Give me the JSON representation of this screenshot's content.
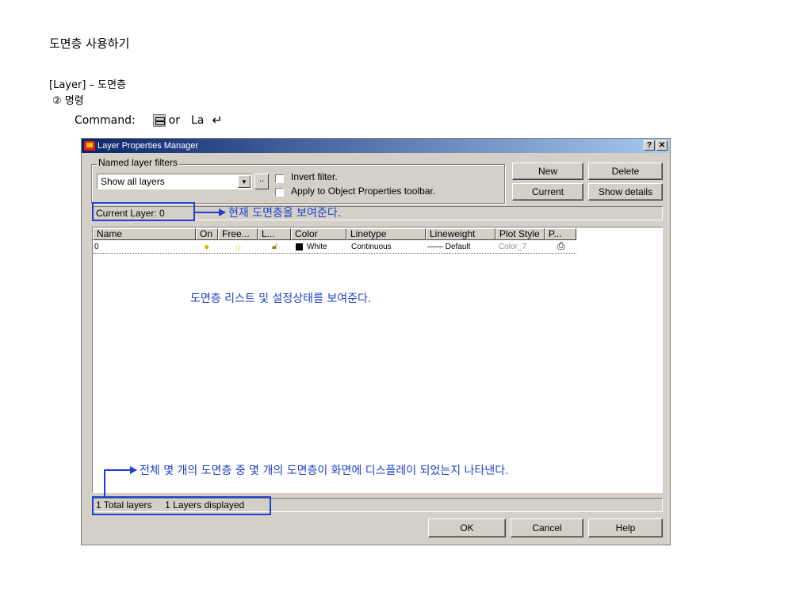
{
  "document": {
    "title": "도면층 사용하기",
    "subtitle": "[Layer] – 도면층",
    "section": "② 명령",
    "command_label": "Command:",
    "command_or": "or",
    "command_alias": "La",
    "enter_glyph": "↵"
  },
  "dialog": {
    "title": "Layer Properties Manager",
    "help_btn": "?",
    "close_btn": "✕",
    "filters": {
      "group_label": "Named layer filters",
      "selected": "Show all layers",
      "more_btn": "··",
      "invert_label": "Invert filter.",
      "apply_label": "Apply to Object Properties toolbar."
    },
    "buttons": {
      "new": "New",
      "delete": "Delete",
      "current": "Current",
      "show_details": "Show details"
    },
    "current_layer": "Current Layer:  0",
    "columns": [
      "Name",
      "On",
      "Free...",
      "L...",
      "Color",
      "Linetype",
      "Lineweight",
      "Plot Style",
      "P..."
    ],
    "rows": [
      {
        "name": "0",
        "color": "White",
        "linetype": "Continuous",
        "lineweight": "—— Default",
        "plot_style": "Color_7"
      }
    ],
    "status": "1 Total layers     1 Layers displayed",
    "bottom_buttons": {
      "ok": "OK",
      "cancel": "Cancel",
      "help": "Help"
    }
  },
  "annotations": {
    "current_layer_note": "현재 도면층을 보여준다.",
    "list_note": "도면층 리스트 및 설정상태를 보여준다.",
    "status_note": "전체 몇 개의 도면층 중 몇 개의 도면층이 화면에 디스플레이 되었는지 나타낸다."
  },
  "colors": {
    "annotation": "#1e40d0",
    "titlebar_start": "#0a246a",
    "titlebar_end": "#a6caf0",
    "dialog_bg": "#d4d0c8"
  }
}
